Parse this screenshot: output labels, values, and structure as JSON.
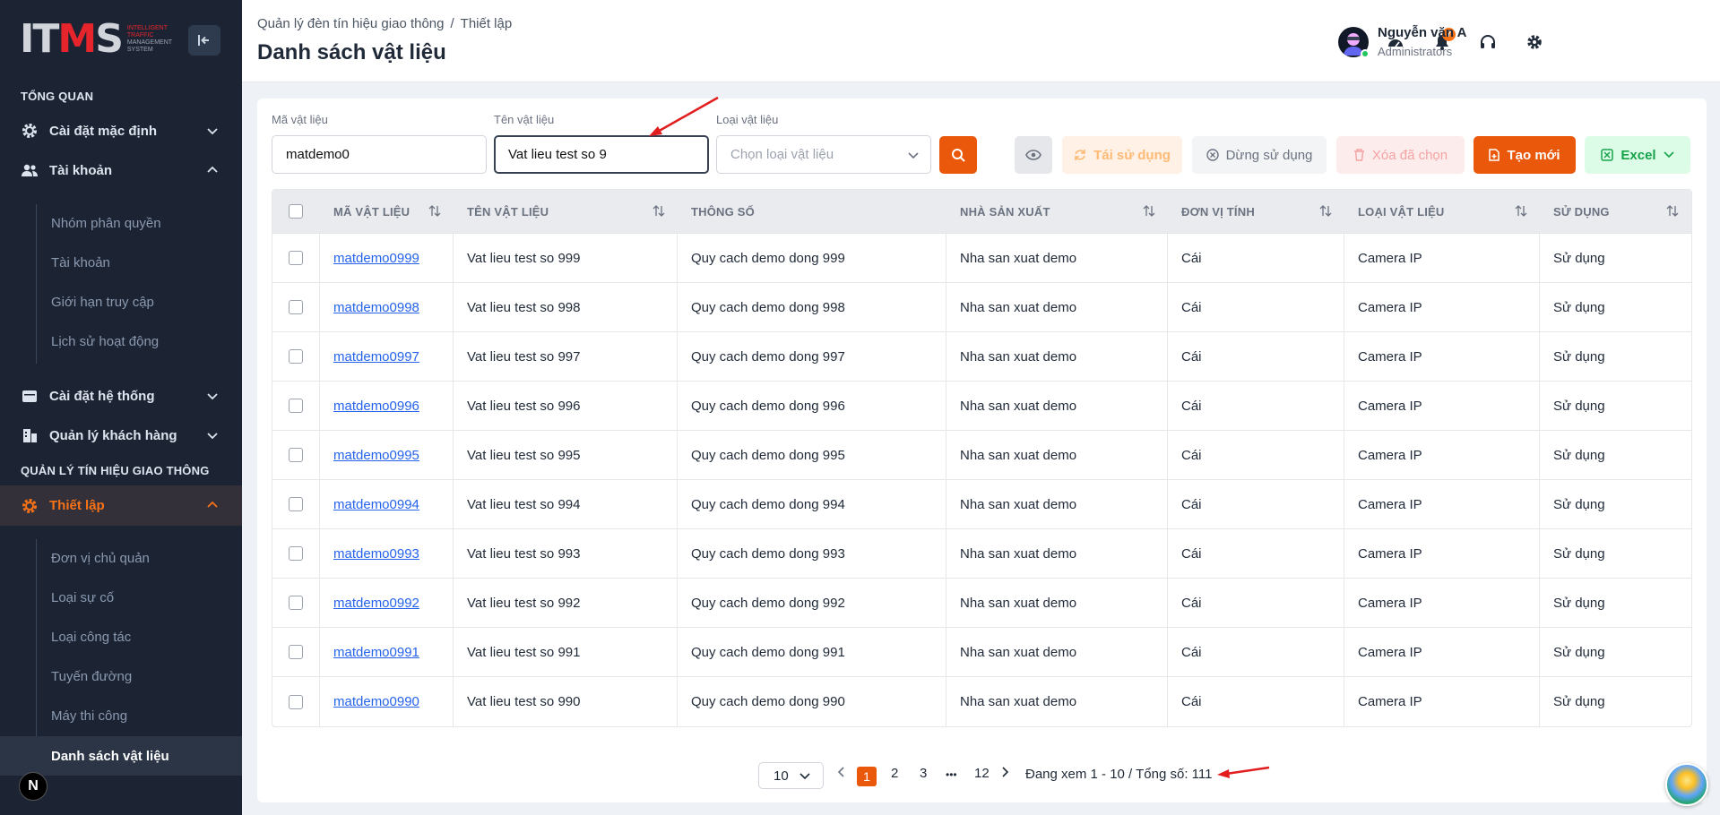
{
  "sidebar": {
    "logo": {
      "mark_a": "IT",
      "mark_b": "M",
      "mark_c": "S",
      "tag1": "INTELLIGENT",
      "tag2": "TRAFFIC",
      "tag3": "MANAGEMENT",
      "tag4": "SYSTEM"
    },
    "section_overview": "TỔNG QUAN",
    "section_traffic": "QUẢN LÝ TÍN HIỆU GIAO THÔNG",
    "items": [
      {
        "label": "Cài đặt mặc định",
        "icon": "gear-icon"
      },
      {
        "label": "Tài khoản",
        "icon": "users-icon"
      },
      {
        "label": "Cài đặt hệ thống",
        "icon": "calendar-icon"
      },
      {
        "label": "Quản lý khách hàng",
        "icon": "building-icon"
      },
      {
        "label": "Thiết lập",
        "icon": "gear-icon"
      }
    ],
    "account_sub": [
      "Nhóm phân quyền",
      "Tài khoản",
      "Giới hạn truy cập",
      "Lịch sử hoạt động"
    ],
    "setup_sub": [
      "Đơn vị chủ quản",
      "Loại sự cố",
      "Loại công tác",
      "Tuyến đường",
      "Máy thi công",
      "Danh sách vật liệu"
    ],
    "next_badge": "N"
  },
  "header": {
    "breadcrumb": [
      "Quản lý đèn tín hiệu giao thông",
      "/",
      "Thiết lập"
    ],
    "title": "Danh sách vật liệu",
    "notification_count": "7",
    "user_name": "Nguyễn văn A",
    "user_role": "Administrators"
  },
  "filters": {
    "code_label": "Mã vật liệu",
    "code_value": "matdemo0",
    "name_label": "Tên vật liệu",
    "name_value": "Vat lieu test so 9",
    "type_label": "Loại vật liệu",
    "type_placeholder": "Chọn loại vật liệu"
  },
  "toolbar": {
    "reuse": "Tái sử dụng",
    "stop": "Dừng sử dụng",
    "delete": "Xóa đã chọn",
    "create": "Tạo mới",
    "excel": "Excel"
  },
  "table": {
    "headers": [
      "MÃ VẬT LIỆU",
      "TÊN VẬT LIỆU",
      "THÔNG SỐ",
      "NHÀ SẢN XUẤT",
      "ĐƠN VỊ TÍNH",
      "LOẠI VẬT LIỆU",
      "SỬ DỤNG"
    ],
    "rows": [
      [
        "matdemo0999",
        "Vat lieu test so 999",
        "Quy cach demo dong 999",
        "Nha san xuat demo",
        "Cái",
        "Camera IP",
        "Sử dụng"
      ],
      [
        "matdemo0998",
        "Vat lieu test so 998",
        "Quy cach demo dong 998",
        "Nha san xuat demo",
        "Cái",
        "Camera IP",
        "Sử dụng"
      ],
      [
        "matdemo0997",
        "Vat lieu test so 997",
        "Quy cach demo dong 997",
        "Nha san xuat demo",
        "Cái",
        "Camera IP",
        "Sử dụng"
      ],
      [
        "matdemo0996",
        "Vat lieu test so 996",
        "Quy cach demo dong 996",
        "Nha san xuat demo",
        "Cái",
        "Camera IP",
        "Sử dụng"
      ],
      [
        "matdemo0995",
        "Vat lieu test so 995",
        "Quy cach demo dong 995",
        "Nha san xuat demo",
        "Cái",
        "Camera IP",
        "Sử dụng"
      ],
      [
        "matdemo0994",
        "Vat lieu test so 994",
        "Quy cach demo dong 994",
        "Nha san xuat demo",
        "Cái",
        "Camera IP",
        "Sử dụng"
      ],
      [
        "matdemo0993",
        "Vat lieu test so 993",
        "Quy cach demo dong 993",
        "Nha san xuat demo",
        "Cái",
        "Camera IP",
        "Sử dụng"
      ],
      [
        "matdemo0992",
        "Vat lieu test so 992",
        "Quy cach demo dong 992",
        "Nha san xuat demo",
        "Cái",
        "Camera IP",
        "Sử dụng"
      ],
      [
        "matdemo0991",
        "Vat lieu test so 991",
        "Quy cach demo dong 991",
        "Nha san xuat demo",
        "Cái",
        "Camera IP",
        "Sử dụng"
      ],
      [
        "matdemo0990",
        "Vat lieu test so 990",
        "Quy cach demo dong 990",
        "Nha san xuat demo",
        "Cái",
        "Camera IP",
        "Sử dụng"
      ]
    ]
  },
  "pagination": {
    "page_size": "10",
    "pages": [
      "1",
      "2",
      "3",
      "•••",
      "12"
    ],
    "current": "1",
    "summary": "Đang xem 1 - 10 / Tổng số: 111"
  },
  "colors": {
    "accent": "#ea580c",
    "sidebar_bg": "#1c2434",
    "link": "#2563eb",
    "annotation": "#e11d1d"
  }
}
